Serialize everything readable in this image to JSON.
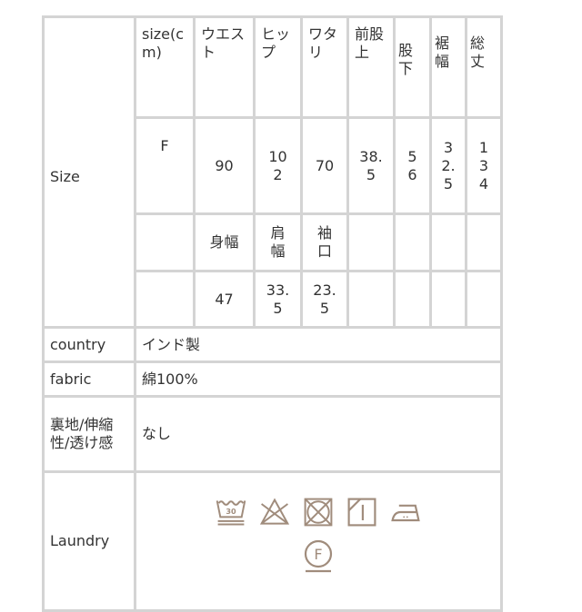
{
  "table": {
    "size_label": "Size",
    "header": {
      "size_cm": "size(cm)",
      "columns": [
        "ウエスト",
        "ヒップ",
        "ワタリ",
        "前股上",
        "股下",
        "裾幅",
        "総丈"
      ]
    },
    "values_row": {
      "size": "F",
      "values": [
        "90",
        "102",
        "70",
        "38.5",
        "56",
        "32.5",
        "134"
      ]
    },
    "sub_header": {
      "columns": [
        "身幅",
        "肩幅",
        "袖口"
      ]
    },
    "sub_values": {
      "values": [
        "47",
        "33.5",
        "23.5"
      ]
    },
    "rows": {
      "country": {
        "label": "country",
        "value": "インド製"
      },
      "fabric": {
        "label": "fabric",
        "value": "綿100%"
      },
      "lining": {
        "label": "裏地/伸縮性/透け感",
        "value": "なし"
      },
      "laundry": {
        "label": "Laundry",
        "icons": [
          "wash-30-gentle-icon",
          "do-not-bleach-icon",
          "do-not-tumble-dry-icon",
          "drip-dry-shade-icon",
          "iron-low-icon",
          "dry-clean-f-gentle-icon"
        ],
        "wash_temp": "30",
        "dry_clean_letter": "F"
      }
    }
  },
  "colors": {
    "border": "#d4d4d4",
    "text": "#333333",
    "icon": "#a08c7c"
  }
}
